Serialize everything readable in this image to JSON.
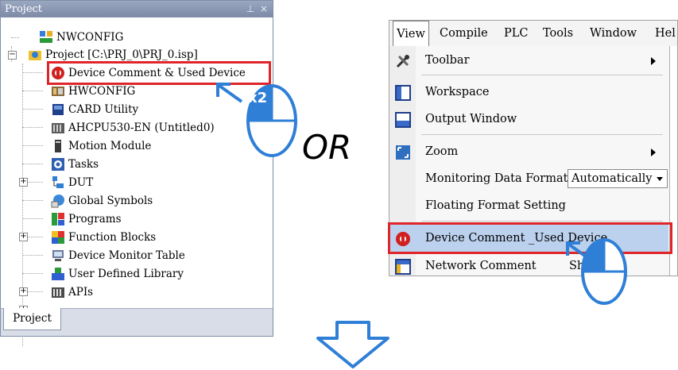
{
  "project_panel": {
    "title": "Project",
    "pin_icon": "pin-icon",
    "close_icon": "close-icon",
    "tree": [
      {
        "label": "NWCONFIG",
        "icon": "nwconfig-icon"
      },
      {
        "label": "Project [C:\\PRJ_0\\PRJ_0.isp]",
        "icon": "project-icon"
      },
      {
        "label": "Device Comment & Used Device",
        "icon": "device-comment-icon"
      },
      {
        "label": "HWCONFIG",
        "icon": "hwconfig-icon"
      },
      {
        "label": "CARD Utility",
        "icon": "card-utility-icon"
      },
      {
        "label": "AHCPU530-EN  (Untitled0)",
        "icon": "cpu-icon"
      },
      {
        "label": "Motion Module",
        "icon": "motion-module-icon"
      },
      {
        "label": "Tasks",
        "icon": "tasks-icon"
      },
      {
        "label": "DUT",
        "icon": "dut-icon"
      },
      {
        "label": "Global Symbols",
        "icon": "global-symbols-icon"
      },
      {
        "label": "Programs",
        "icon": "programs-icon"
      },
      {
        "label": "Function Blocks",
        "icon": "function-blocks-icon"
      },
      {
        "label": "Device Monitor Table",
        "icon": "device-monitor-icon"
      },
      {
        "label": "User Defined Library",
        "icon": "user-library-icon"
      },
      {
        "label": "APIs",
        "icon": "apis-icon"
      }
    ],
    "tab_label": "Project",
    "double_click_badge": "x2",
    "expander_sign": "+",
    "collapse_sign": "−"
  },
  "or_text": "OR",
  "view_menu": {
    "menubar": [
      "View",
      "Compile",
      "PLC",
      "Tools",
      "Window",
      "Hel"
    ],
    "items": [
      {
        "label": "Toolbar",
        "icon": "toolbar-tools-icon"
      },
      {
        "label": "Workspace",
        "icon": "workspace-icon"
      },
      {
        "label": "Output Window",
        "icon": "output-window-icon"
      },
      {
        "label": "Zoom",
        "icon": "zoom-icon"
      },
      {
        "label": "Monitoring Data Format",
        "icon": ""
      },
      {
        "label": "Floating Format Setting",
        "icon": ""
      },
      {
        "label": "Device Comment _Used Device",
        "icon": "device-comment-icon"
      },
      {
        "label": "Network Comment",
        "icon": "network-comment-icon"
      }
    ],
    "monitoring_format_value": "Automatically",
    "shortcut_text": "Shift+C"
  },
  "colors": {
    "highlight_red": "#e0252a",
    "accent_blue": "#2f7fd7",
    "menu_highlight": "#bcd1ee"
  }
}
